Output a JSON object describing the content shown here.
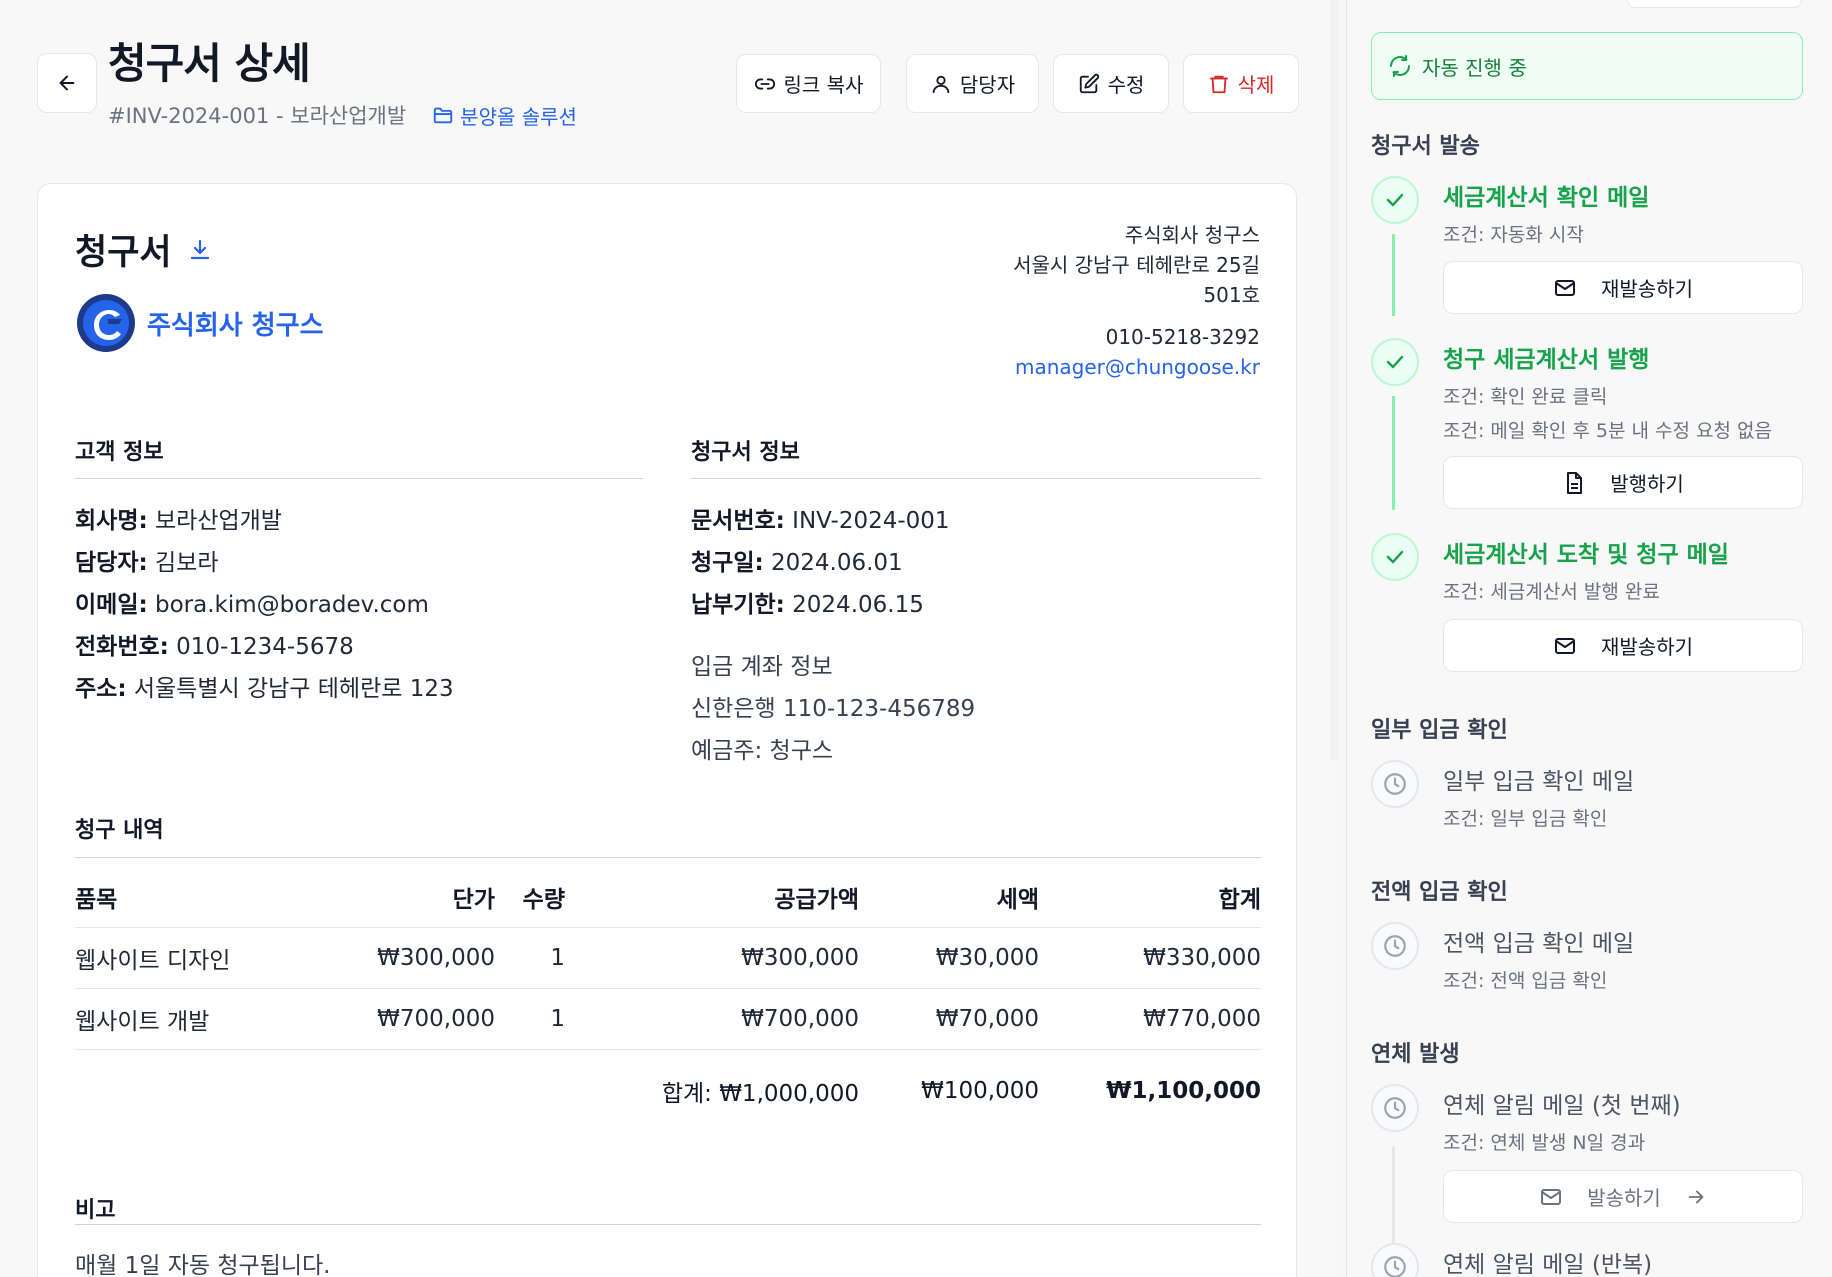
{
  "header": {
    "title": "청구서 상세",
    "invoice_ref": "#INV-2024-001 - 보라산업개발",
    "project_label": "분양올 솔루션",
    "actions": {
      "copy_link": "링크 복사",
      "assignee": "담당자",
      "edit": "수정",
      "delete": "삭제"
    }
  },
  "invoice": {
    "heading": "청구서",
    "company_name": "주식회사 청구스",
    "issuer": {
      "name": "주식회사 청구스",
      "address_line1": "서울시 강남구 테헤란로 25길",
      "address_line2": "501호",
      "phone": "010-5218-3292",
      "email": "manager@chungoose.kr"
    },
    "customer": {
      "section_title": "고객 정보",
      "company_label": "회사명:",
      "company": "보라산업개발",
      "contact_label": "담당자:",
      "contact": "김보라",
      "email_label": "이메일:",
      "email": "bora.kim@boradev.com",
      "phone_label": "전화번호:",
      "phone": "010-1234-5678",
      "address_label": "주소:",
      "address": "서울특별시 강남구 테헤란로 123"
    },
    "details": {
      "section_title": "청구서 정보",
      "doc_no_label": "문서번호:",
      "doc_no": "INV-2024-001",
      "issue_date_label": "청구일:",
      "issue_date": "2024.06.01",
      "due_date_label": "납부기한:",
      "due_date": "2024.06.15",
      "bank_title": "입금 계좌 정보",
      "bank_account": "신한은행 110-123-456789",
      "account_holder": "예금주: 청구스"
    },
    "items": {
      "section_title": "청구 내역",
      "columns": [
        "품목",
        "단가",
        "수량",
        "공급가액",
        "세액",
        "합계"
      ],
      "rows": [
        [
          "웹사이트 디자인",
          "₩300,000",
          "1",
          "₩300,000",
          "₩30,000",
          "₩330,000"
        ],
        [
          "웹사이트 개발",
          "₩700,000",
          "1",
          "₩700,000",
          "₩70,000",
          "₩770,000"
        ]
      ],
      "total_supply": "합계: ₩1,000,000",
      "total_tax": "₩100,000",
      "grand_total": "₩1,100,000"
    },
    "notes": {
      "section_title": "비고",
      "text": "매월 1일 자동 청구됩니다."
    }
  },
  "sidebar": {
    "auto_status": "자동 진행 중",
    "groups": [
      {
        "title": "청구서 발송",
        "steps": [
          {
            "title": "세금계산서 확인 메일",
            "conditions": [
              "조건: 자동화 시작"
            ],
            "action": "재발송하기",
            "action_icon": "mail-icon",
            "status": "done"
          },
          {
            "title": "청구 세금계산서 발행",
            "conditions": [
              "조건: 확인 완료 클릭",
              "조건: 메일 확인 후 5분 내 수정 요청 없음"
            ],
            "action": "발행하기",
            "action_icon": "document-icon",
            "status": "done"
          },
          {
            "title": "세금계산서 도착 및 청구 메일",
            "conditions": [
              "조건: 세금계산서 발행 완료"
            ],
            "action": "재발송하기",
            "action_icon": "mail-icon",
            "status": "done"
          }
        ]
      },
      {
        "title": "일부 입금 확인",
        "steps": [
          {
            "title": "일부 입금 확인 메일",
            "conditions": [
              "조건: 일부 입금 확인"
            ],
            "status": "waiting"
          }
        ]
      },
      {
        "title": "전액 입금 확인",
        "steps": [
          {
            "title": "전액 입금 확인 메일",
            "conditions": [
              "조건: 전액 입금 확인"
            ],
            "status": "waiting"
          }
        ]
      },
      {
        "title": "연체 발생",
        "steps": [
          {
            "title": "연체 알림 메일 (첫 번째)",
            "conditions": [
              "조건: 연체 발생 N일 경과"
            ],
            "action": "발송하기",
            "action_icon": "mail-icon",
            "status": "waiting"
          },
          {
            "title": "연체 알림 메일 (반복)",
            "conditions": [],
            "status": "waiting"
          }
        ]
      }
    ]
  },
  "colors": {
    "accent": "#2563eb",
    "success": "#16a34a",
    "danger": "#dc2626"
  }
}
